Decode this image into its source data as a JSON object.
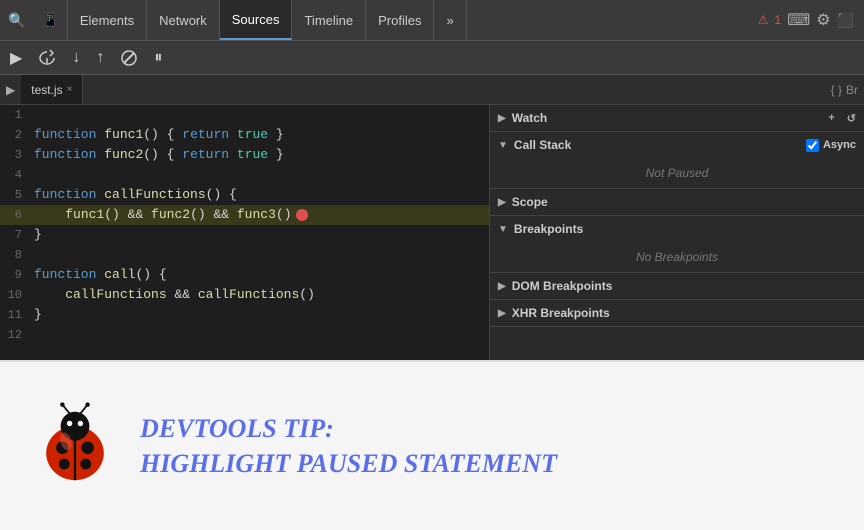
{
  "toolbar": {
    "tabs": [
      {
        "label": "Elements",
        "active": false
      },
      {
        "label": "Network",
        "active": false
      },
      {
        "label": "Sources",
        "active": true
      },
      {
        "label": "Timeline",
        "active": false
      },
      {
        "label": "Profiles",
        "active": false
      }
    ],
    "more_tabs": "»",
    "badge": "1",
    "terminal_icon": "⌨",
    "gear_icon": "⚙",
    "monitor_icon": "⬜"
  },
  "debug_toolbar": {
    "pause_btn": "⏸",
    "step_over_btn": "↩",
    "step_into_btn": "↓",
    "step_out_btn": "↑",
    "deactivate_btn": "⊘",
    "pause_exceptions_btn": "⏸"
  },
  "file_tab": {
    "name": "test.js",
    "close": "×"
  },
  "code": {
    "lines": [
      {
        "num": "1",
        "content": "",
        "tokens": []
      },
      {
        "num": "2",
        "content": "function func1() { return true }",
        "highlight": false
      },
      {
        "num": "3",
        "content": "function func2() { return true }",
        "highlight": false
      },
      {
        "num": "4",
        "content": "",
        "tokens": []
      },
      {
        "num": "5",
        "content": "function callFunctions() {",
        "highlight": false
      },
      {
        "num": "6",
        "content": "    func1() && func2() && func3()",
        "highlight": true,
        "error": true
      },
      {
        "num": "7",
        "content": "}",
        "highlight": false
      },
      {
        "num": "8",
        "content": "",
        "tokens": []
      },
      {
        "num": "9",
        "content": "function call() {",
        "highlight": false
      },
      {
        "num": "10",
        "content": "    callFunctions && callFunctions()",
        "highlight": false
      },
      {
        "num": "11",
        "content": "}",
        "highlight": false
      },
      {
        "num": "12",
        "content": "",
        "tokens": []
      }
    ]
  },
  "right_panel": {
    "sections": [
      {
        "id": "watch",
        "label": "Watch",
        "expanded": false,
        "arrow": "▶",
        "actions": [
          "+",
          "↺"
        ]
      },
      {
        "id": "call-stack",
        "label": "Call Stack",
        "expanded": true,
        "arrow": "▼",
        "async_label": "Async",
        "not_paused": "Not Paused"
      },
      {
        "id": "scope",
        "label": "Scope",
        "expanded": false,
        "arrow": "▶"
      },
      {
        "id": "breakpoints",
        "label": "Breakpoints",
        "expanded": true,
        "arrow": "▼",
        "no_breakpoints": "No Breakpoints"
      },
      {
        "id": "dom-breakpoints",
        "label": "DOM Breakpoints",
        "expanded": false,
        "arrow": "▶"
      },
      {
        "id": "xhr-breakpoints",
        "label": "XHR Breakpoints",
        "expanded": false,
        "arrow": "▶"
      }
    ]
  },
  "tip": {
    "title": "DevTools Tip:",
    "subtitle": "Highlight Paused Statement"
  }
}
